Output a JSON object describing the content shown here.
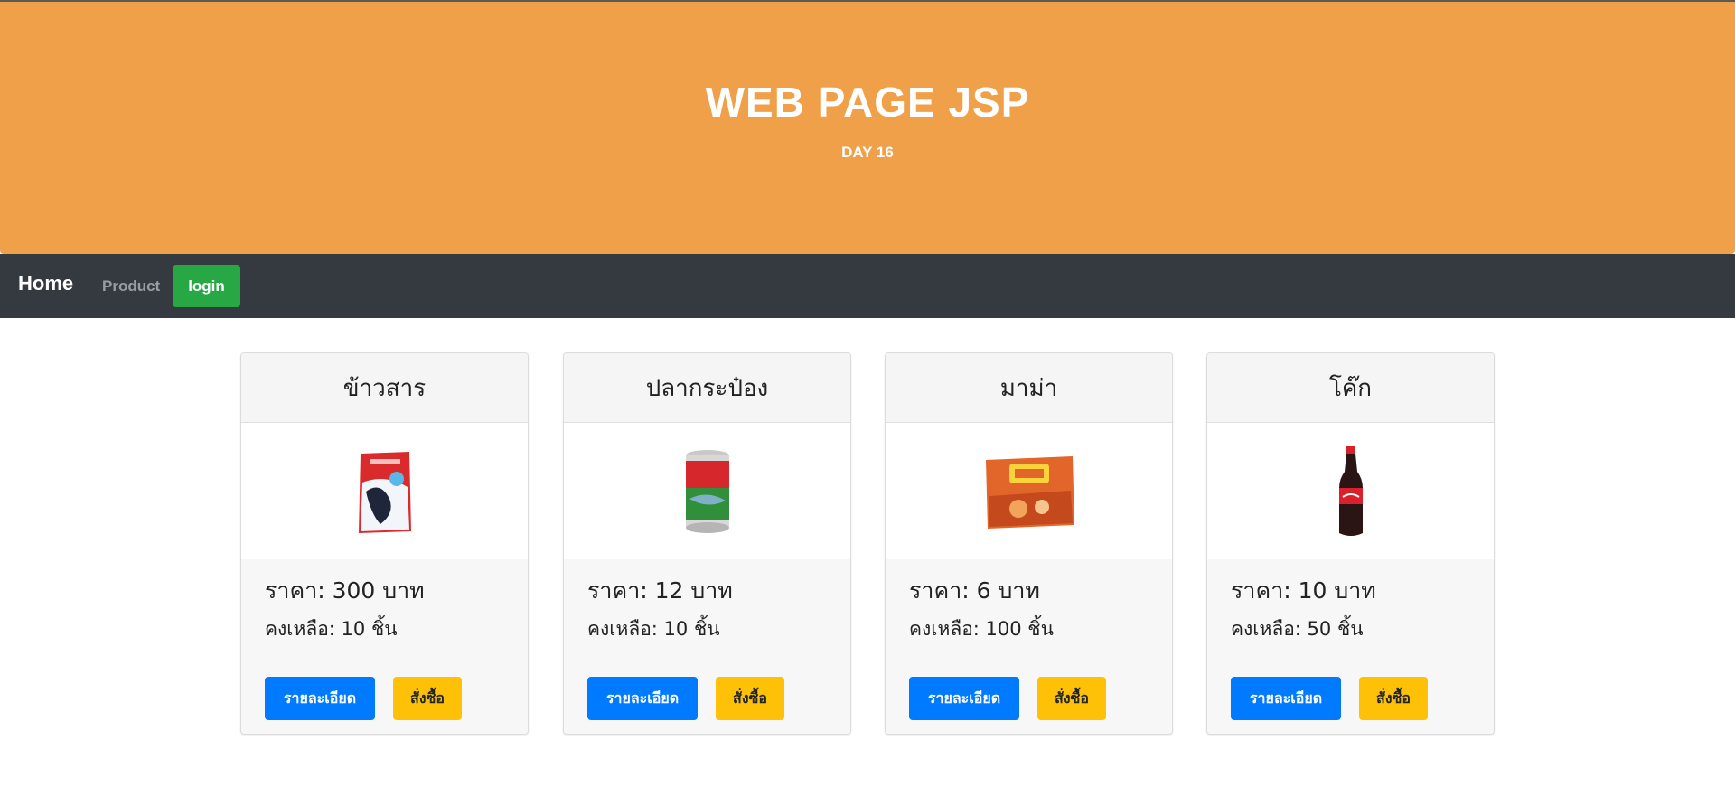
{
  "hero": {
    "title": "WEB PAGE JSP",
    "subtitle": "DAY 16",
    "bg_color": "#f0a048"
  },
  "navbar": {
    "brand": "Home",
    "product": "Product",
    "login": "login",
    "bg_color": "#343a40"
  },
  "products": [
    {
      "name": "ข้าวสาร",
      "price": "ราคา: 300 บาท",
      "stock": "คงเหลือ: 10 ชิ้น",
      "detail_label": "รายละเอียด",
      "buy_label": "สั่งซื้อ",
      "image_icon": "rice-bag-image"
    },
    {
      "name": "ปลากระป๋อง",
      "price": "ราคา: 12 บาท",
      "stock": "คงเหลือ: 10 ชิ้น",
      "detail_label": "รายละเอียด",
      "buy_label": "สั่งซื้อ",
      "image_icon": "canned-fish-image"
    },
    {
      "name": "มาม่า",
      "price": "ราคา: 6 บาท",
      "stock": "คงเหลือ: 100 ชิ้น",
      "detail_label": "รายละเอียด",
      "buy_label": "สั่งซื้อ",
      "image_icon": "instant-noodle-image"
    },
    {
      "name": "โค๊ก",
      "price": "ราคา: 10 บาท",
      "stock": "คงเหลือ: 50 ชิ้น",
      "detail_label": "รายละเอียด",
      "buy_label": "สั่งซื้อ",
      "image_icon": "cola-bottle-image"
    }
  ],
  "colors": {
    "detail_button": "#007bff",
    "buy_button": "#ffc107",
    "login_button": "#28a745"
  }
}
